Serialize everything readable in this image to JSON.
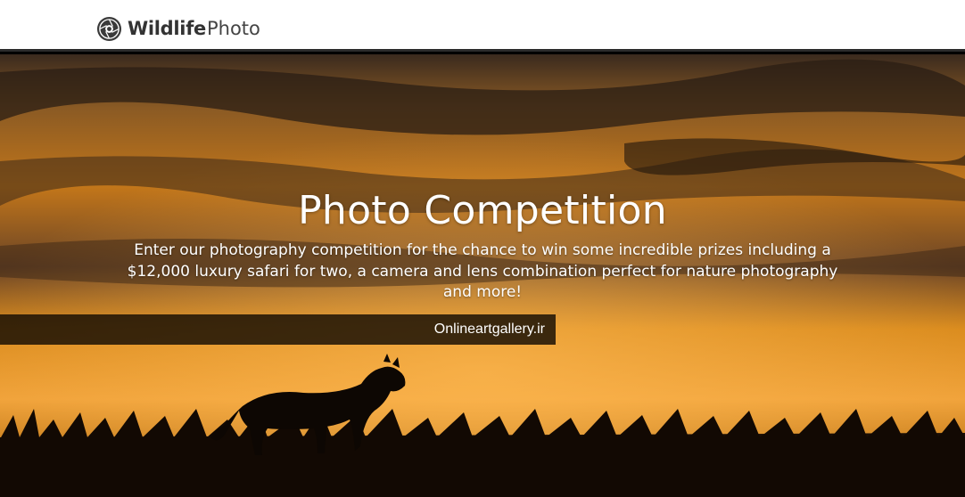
{
  "header": {
    "brand_bold": "Wildlife",
    "brand_light": "Photo",
    "logo_icon": "aperture-leopard-logo-icon"
  },
  "hero": {
    "title": "Photo Competition",
    "description": "Enter our photography competition for the chance to win some incredible prizes including a $12,000 luxury safari for two, a camera and lens combination perfect for nature photography and more!",
    "watermark": "Onlineartgallery.ir",
    "background": "cheetah-silhouette-sunset-image"
  },
  "colors": {
    "header_bg": "#ffffff",
    "sky_orange": "#e8901a",
    "sky_dark": "#2a1c10",
    "text_light": "#ffffff"
  }
}
